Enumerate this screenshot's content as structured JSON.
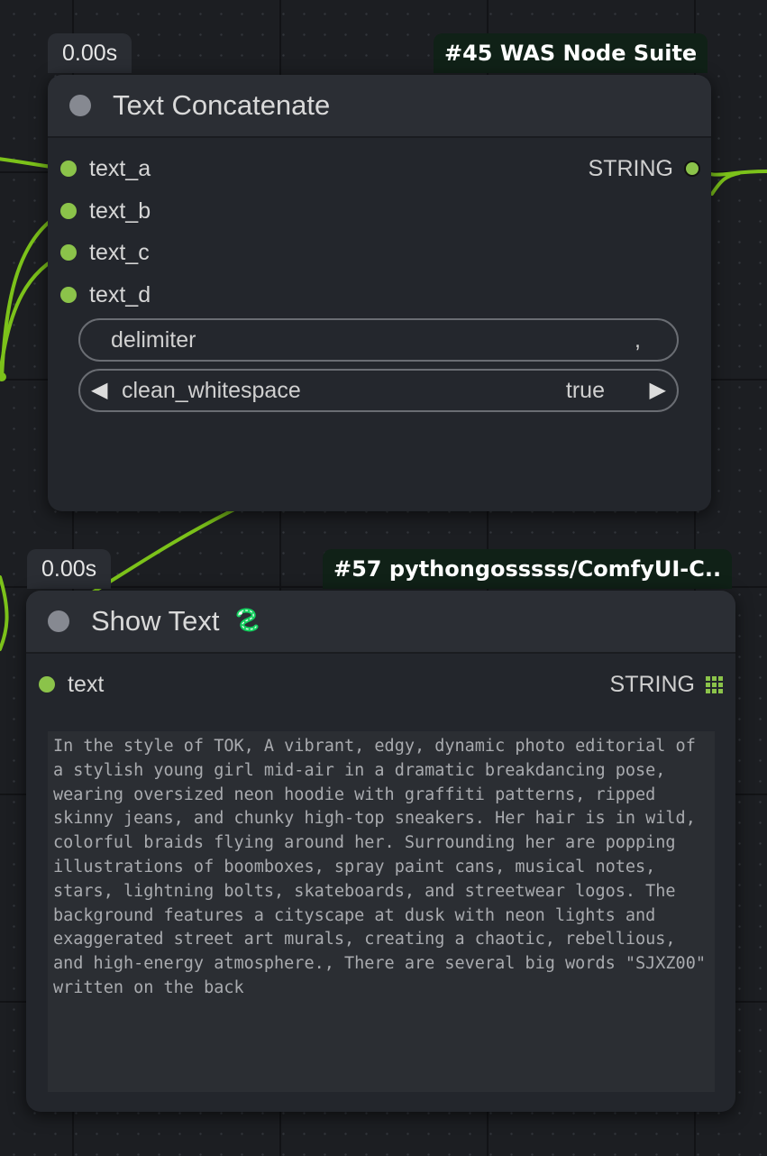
{
  "colors": {
    "slot_green": "#8bc34a",
    "node_bg": "#23262c",
    "header_bg": "#2b2e34",
    "source_badge_bg": "#102117",
    "wire": "#7cc21a"
  },
  "node1": {
    "time": "0.00s",
    "source": "#45 WAS Node Suite",
    "title": "Text Concatenate",
    "inputs": [
      "text_a",
      "text_b",
      "text_c",
      "text_d"
    ],
    "output_type": "STRING",
    "delimiter": {
      "label": "delimiter",
      "value": ","
    },
    "clean_whitespace": {
      "label": "clean_whitespace",
      "value": "true",
      "left_arrow": "◀",
      "right_arrow": "▶"
    }
  },
  "node2": {
    "time": "0.00s",
    "source": "#57 pythongosssss/ComfyUI-C..",
    "title": "Show Text",
    "title_icon": "snake-icon",
    "input": "text",
    "output_type": "STRING",
    "output_icon": "grid-icon",
    "text_value": "In the style of TOK, A vibrant, edgy, dynamic photo editorial of a stylish young girl mid-air in a dramatic breakdancing pose, wearing oversized neon hoodie with graffiti patterns, ripped skinny jeans, and chunky high-top sneakers. Her hair is in wild, colorful braids flying around her. Surrounding her are popping illustrations of boomboxes, spray paint cans, musical notes, stars, lightning bolts, skateboards, and streetwear logos. The background features a cityscape at dusk with neon lights and exaggerated street art murals, creating a chaotic, rebellious, and high-energy atmosphere., There are several big words \"SJXZ00\" written on the back"
  }
}
